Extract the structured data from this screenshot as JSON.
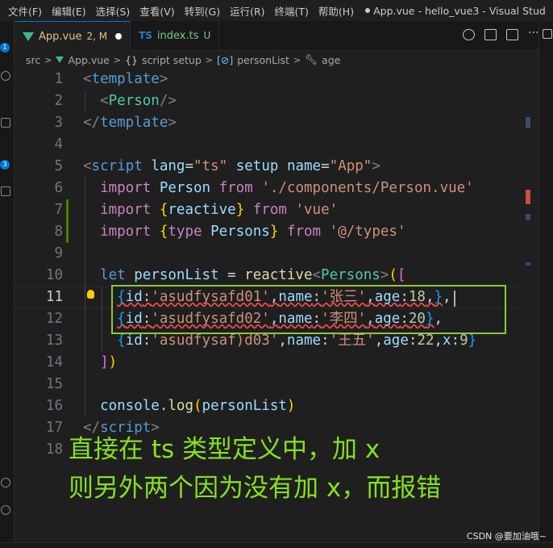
{
  "menu": {
    "items": [
      "文件(F)",
      "编辑(E)",
      "选择(S)",
      "查看(V)",
      "转到(G)",
      "运行(R)",
      "终端(T)",
      "帮助(H)"
    ],
    "window_title": "App.vue - hello_vue3 - Visual Stud"
  },
  "activity": {
    "badge_top": "1",
    "badge_mid": "3"
  },
  "tabs": [
    {
      "name": "App.vue",
      "status": "2, M",
      "icon": "vue-icon",
      "active": true,
      "dirty": true
    },
    {
      "name": "index.ts",
      "status": "U",
      "icon": "ts-icon",
      "active": false
    }
  ],
  "tab_icon_ts": "TS",
  "breadcrumb": {
    "items": [
      "src",
      "App.vue",
      "script setup",
      "personList",
      "age"
    ]
  },
  "editor": {
    "current_line": 11,
    "lines": [
      {
        "n": "1"
      },
      {
        "n": "2"
      },
      {
        "n": "3"
      },
      {
        "n": "4"
      },
      {
        "n": "5"
      },
      {
        "n": "6"
      },
      {
        "n": "7"
      },
      {
        "n": "8"
      },
      {
        "n": "9"
      },
      {
        "n": "10"
      },
      {
        "n": "11"
      },
      {
        "n": "12"
      },
      {
        "n": "13"
      },
      {
        "n": "14"
      },
      {
        "n": "15"
      },
      {
        "n": "16"
      },
      {
        "n": "17"
      },
      {
        "n": "18"
      }
    ],
    "tokens": {
      "template": "template",
      "person": "Person",
      "script": "script",
      "lang": "lang",
      "ts": "\"ts\"",
      "setup": "setup",
      "name": "name",
      "app": "\"App\"",
      "import": "import",
      "from": "from",
      "person_path": "'./components/Person.vue'",
      "reactive": "reactive",
      "vue": "'vue'",
      "type": "type",
      "persons": "Persons",
      "types_path": "'@/types'",
      "let": "let",
      "personList": "personList",
      "id1": "'asudfysafd01'",
      "name1": "'张三'",
      "age1": "18",
      "id2": "'asudfysafd02'",
      "name2": "'李四'",
      "age2": "20",
      "id3": "'asudfysaf)d03'",
      "name3": "'王五'",
      "age3": "22",
      "x3": "9",
      "console": "console",
      "log": "log",
      "k_id": "id",
      "k_name": "name",
      "k_age": "age",
      "k_x": "x"
    }
  },
  "overlay": {
    "line1": "直接在 ts 类型定义中，加 x",
    "line2": "则另外两个因为没有加 x，而报错"
  },
  "watermark": "CSDN @要加油哦~",
  "colors": {
    "accent": "#0078d4",
    "annotation_green": "#86e021",
    "box_green": "#8cc63f",
    "vue_green": "#42b883"
  }
}
